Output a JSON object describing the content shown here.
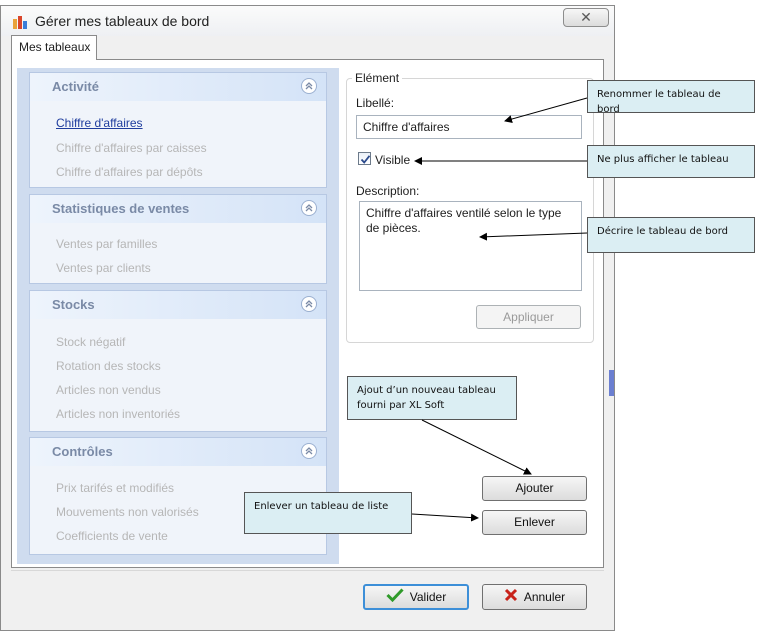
{
  "window": {
    "title": "Gérer mes tableaux de bord",
    "close_glyph": "✕"
  },
  "tabs": [
    {
      "label": "Mes tableaux",
      "selected": true
    }
  ],
  "groups": [
    {
      "title": "Activité",
      "items": [
        {
          "label": "Chiffre d'affaires",
          "active": true
        },
        {
          "label": "Chiffre d'affaires par caisses",
          "active": false
        },
        {
          "label": "Chiffre d'affaires par dépôts",
          "active": false
        }
      ]
    },
    {
      "title": "Statistiques de ventes",
      "items": [
        {
          "label": "Ventes par familles",
          "active": false
        },
        {
          "label": "Ventes par clients",
          "active": false
        }
      ]
    },
    {
      "title": "Stocks",
      "items": [
        {
          "label": "Stock négatif",
          "active": false
        },
        {
          "label": "Rotation des stocks",
          "active": false
        },
        {
          "label": "Articles non vendus",
          "active": false
        },
        {
          "label": "Articles non inventoriés",
          "active": false
        }
      ]
    },
    {
      "title": "Contrôles",
      "items": [
        {
          "label": "Prix tarifés et modifiés",
          "active": false
        },
        {
          "label": "Mouvements non valorisés",
          "active": false
        },
        {
          "label": "Coefficients de vente",
          "active": false
        }
      ]
    }
  ],
  "element": {
    "legend": "Elément",
    "libelle_label": "Libellé:",
    "libelle_value": "Chiffre d'affaires",
    "visible_label": "Visible",
    "visible_checked": true,
    "description_label": "Description:",
    "description_value": "Chiffre d'affaires ventilé selon le type de pièces.",
    "apply_label": "Appliquer"
  },
  "actions": {
    "add_label": "Ajouter",
    "remove_label": "Enlever"
  },
  "footer": {
    "ok_label": "Valider",
    "cancel_label": "Annuler"
  },
  "callouts": {
    "rename": "Renommer le tableau de bord",
    "hide": "Ne plus afficher le tableau",
    "describe": "Décrire le tableau de bord",
    "add": "Ajout d’un nouveau tableau fourni par XL Soft",
    "remove": "Enlever un tableau de liste"
  },
  "colors": {
    "accent": "#3d8fd8",
    "nav_bg": "#cfdcef",
    "callout_bg": "#dbeef3",
    "link": "#1f3d9e"
  }
}
